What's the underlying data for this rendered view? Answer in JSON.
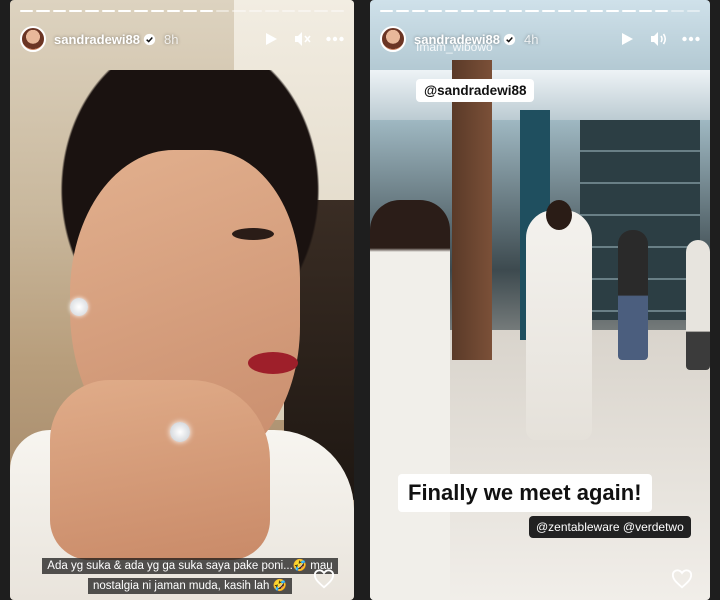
{
  "stories": [
    {
      "username": "sandradewi88",
      "time": "8h",
      "caption": "Ada yg suka & ada yg ga suka saya pake poni...🤣 mau nostalgia ni jaman muda, kasih lah 🤣"
    },
    {
      "username": "sandradewi88",
      "time": "4h",
      "sub_user": "Imam_wibowo",
      "mention": "@sandradewi88",
      "caption": "Finally we meet again!",
      "mentions_bottom": "@zentableware @verdetwo"
    }
  ],
  "icons": {
    "play": "play-icon",
    "mute": "mute-icon",
    "volume": "volume-icon",
    "more": "more-icon",
    "like": "heart-icon",
    "verified": "verified-icon"
  }
}
